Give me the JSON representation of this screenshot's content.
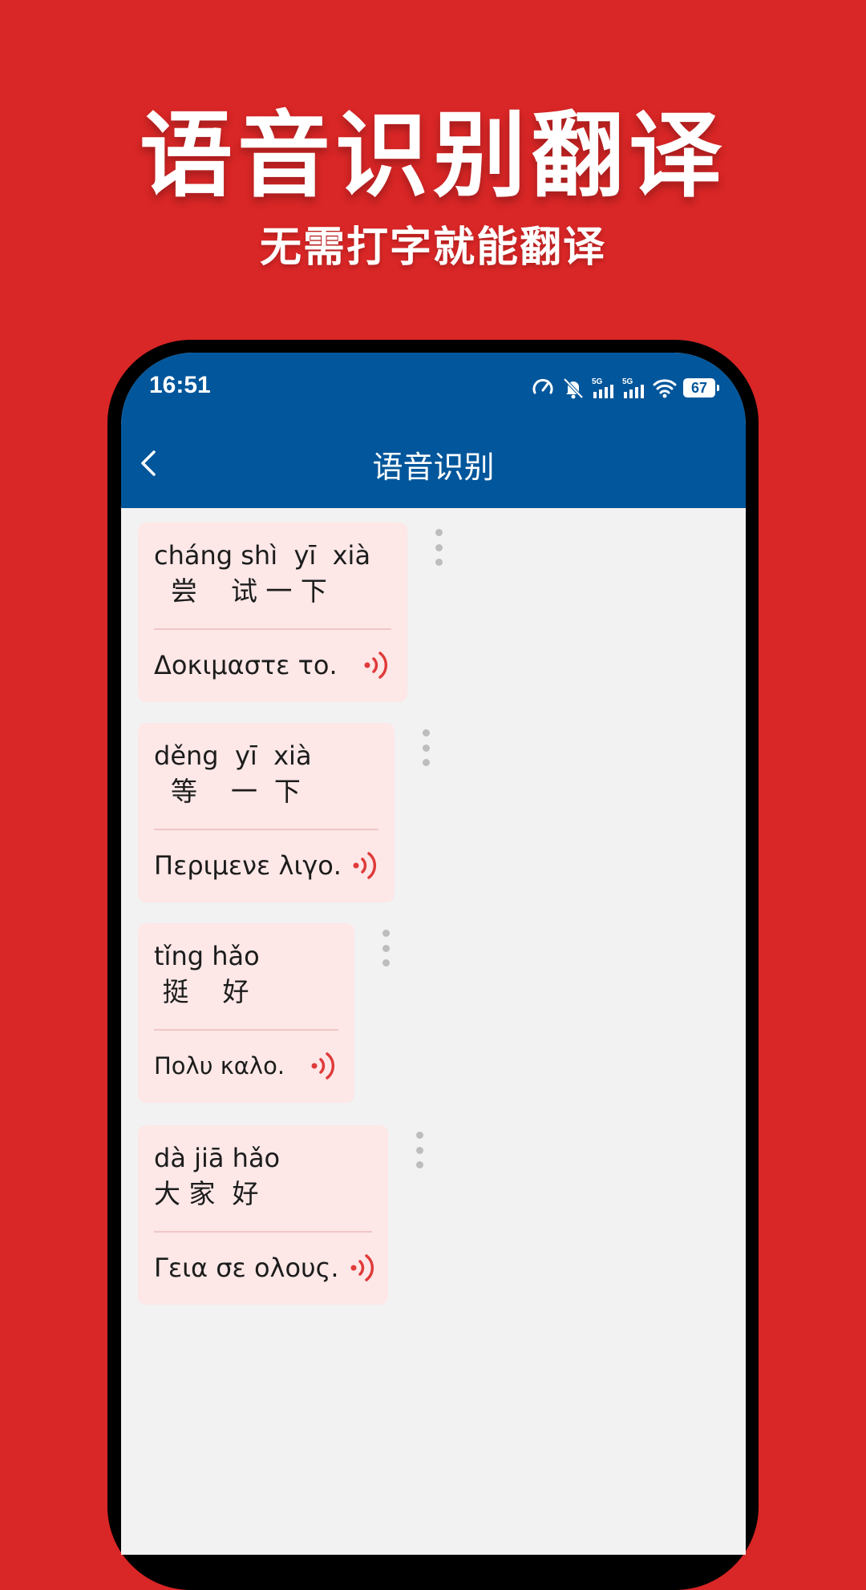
{
  "promo": {
    "title": "语音识别翻译",
    "subtitle": "无需打字就能翻译"
  },
  "status_bar": {
    "time": "16:51",
    "battery": "67",
    "icons": [
      "speedometer-icon",
      "bell-muted-icon",
      "signal-5g-icon",
      "signal-5g-icon",
      "wifi-icon",
      "battery-icon"
    ]
  },
  "header": {
    "title": "语音识别",
    "back_icon": "chevron-left-icon"
  },
  "colors": {
    "background": "#d92626",
    "header": "#02569b",
    "card": "#fde7e7",
    "speaker": "#e03a3a"
  },
  "messages": [
    {
      "pinyin": "cháng shì  yī  xià",
      "hanzi": "  尝    试 一 下",
      "translation": "Δοκιμαστε το."
    },
    {
      "pinyin": "děng  yī  xià",
      "hanzi": "  等    一  下",
      "translation": "Περιμενε λιγο."
    },
    {
      "pinyin": "tǐng hǎo",
      "hanzi": " 挺    好",
      "translation": "Πολυ καλο."
    },
    {
      "pinyin": "dà jiā hǎo",
      "hanzi": "大 家  好",
      "translation": "Γεια σε ολους."
    }
  ]
}
